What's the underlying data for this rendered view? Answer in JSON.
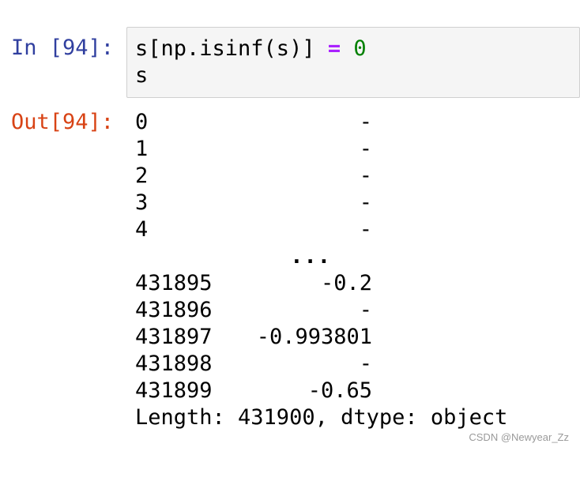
{
  "cell": {
    "input_prompt": "In [94]:",
    "output_prompt": "Out[94]:",
    "code": {
      "line1_a": "s[np.isinf(s)] ",
      "line1_op": "=",
      "line1_sp": " ",
      "line1_num": "0",
      "line2": "s"
    }
  },
  "output": {
    "head_rows": [
      {
        "index": "0",
        "value": "-"
      },
      {
        "index": "1",
        "value": "-"
      },
      {
        "index": "2",
        "value": "-"
      },
      {
        "index": "3",
        "value": "-"
      },
      {
        "index": "4",
        "value": "-"
      }
    ],
    "ellipsis": "...",
    "tail_rows": [
      {
        "index": "431895",
        "value": "-0.2"
      },
      {
        "index": "431896",
        "value": "-"
      },
      {
        "index": "431897",
        "value": "-0.993801"
      },
      {
        "index": "431898",
        "value": "-"
      },
      {
        "index": "431899",
        "value": "-0.65"
      }
    ],
    "footer": "Length: 431900, dtype: object"
  },
  "watermark": "CSDN @Newyear_Zz",
  "colors": {
    "input_prompt": "#303F9F",
    "output_prompt": "#D84315",
    "operator": "#AA22FF",
    "number": "#008000"
  }
}
